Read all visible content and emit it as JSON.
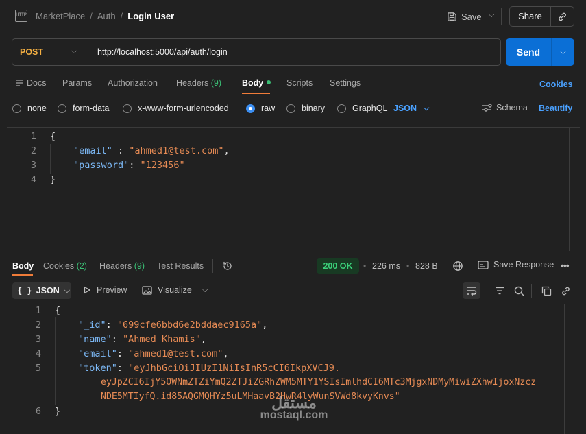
{
  "breadcrumb": {
    "items": [
      "MarketPlace",
      "Auth"
    ],
    "current": "Login User",
    "icon_text": "HTTP"
  },
  "header": {
    "save_label": "Save",
    "share_label": "Share"
  },
  "request": {
    "method": "POST",
    "url": "http://localhost:5000/api/auth/login",
    "send_label": "Send"
  },
  "req_tabs": [
    {
      "label": "Docs"
    },
    {
      "label": "Params"
    },
    {
      "label": "Authorization"
    },
    {
      "label": "Headers",
      "count": "(9)"
    },
    {
      "label": "Body"
    },
    {
      "label": "Scripts"
    },
    {
      "label": "Settings"
    }
  ],
  "cookies_label": "Cookies",
  "body_types": [
    "none",
    "form-data",
    "x-www-form-urlencoded",
    "raw",
    "binary",
    "GraphQL"
  ],
  "body_type_selected": "raw",
  "body_format": "JSON",
  "schema_label": "Schema",
  "beautify_label": "Beautify",
  "request_body": {
    "line_numbers": [
      "1",
      "2",
      "3",
      "4"
    ],
    "open": "{",
    "close": "}",
    "fields": [
      {
        "key": "\"email\"",
        "sep": " : ",
        "value": "\"ahmed1@test.com\"",
        "trail": ","
      },
      {
        "key": "\"password\"",
        "sep": ": ",
        "value": "\"123456\"",
        "trail": ""
      }
    ]
  },
  "resp_tabs": [
    {
      "label": "Body"
    },
    {
      "label": "Cookies",
      "count": "(2)"
    },
    {
      "label": "Headers",
      "count": "(9)"
    },
    {
      "label": "Test Results"
    }
  ],
  "response": {
    "status": "200 OK",
    "time": "226 ms",
    "size": "828 B",
    "save_label": "Save Response",
    "format": "JSON",
    "preview_label": "Preview",
    "visualize_label": "Visualize",
    "line_numbers": [
      "1",
      "2",
      "3",
      "4",
      "5",
      "6"
    ],
    "open": "{",
    "close": "}",
    "fields": [
      {
        "key": "\"_id\"",
        "sep": ": ",
        "value": "\"699cfe6bbd6e2bddaec9165a\"",
        "trail": ","
      },
      {
        "key": "\"name\"",
        "sep": ": ",
        "value": "\"Ahmed Khamis\"",
        "trail": ","
      },
      {
        "key": "\"email\"",
        "sep": ": ",
        "value": "\"ahmed1@test.com\"",
        "trail": ","
      },
      {
        "key": "\"token\"",
        "sep": ": ",
        "value_lines": [
          "\"eyJhbGciOiJIUzI1NiIsInR5cCI6IkpXVCJ9.",
          "eyJpZCI6IjY5OWNmZTZiYmQ2ZTJiZGRhZWM5MTY1YSIsImlhdCI6MTc3MjgxNDMyMiwiZXhwIjoxNzcz",
          "NDE5MTIyfQ.id85AQGMQHYz5uLMHaavB2HwR4lyWunSVWd8kvyKnvs\""
        ]
      }
    ]
  },
  "watermark": {
    "arabic": "مستقل",
    "latin": "mostaql.com"
  },
  "colors": {
    "accent": "#0b6fd6",
    "method": "#f5b042",
    "ok": "#3bd17a",
    "link": "#4aa1ff",
    "active_tab": "#f07c39"
  }
}
